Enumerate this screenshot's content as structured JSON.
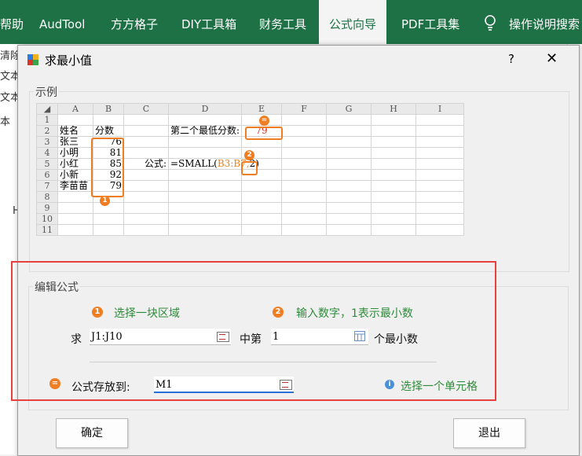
{
  "ribbon": {
    "tabs": [
      "帮助",
      "AudTool",
      "方方格子",
      "DIY工具箱",
      "财务工具",
      "公式向导",
      "PDF工具集",
      "操作说明搜索"
    ]
  },
  "bg_sheet": {
    "texts": [
      "清除",
      "文本",
      "文本",
      "本",
      "H"
    ]
  },
  "dialog": {
    "title": "求最小值",
    "help_label": "?",
    "close_label": "✕",
    "example_group": {
      "title": "示例",
      "columns": [
        "A",
        "B",
        "C",
        "D",
        "E",
        "F",
        "G",
        "H",
        "I"
      ],
      "rows": [
        "1",
        "2",
        "3",
        "4",
        "5",
        "6",
        "7",
        "8",
        "9",
        "10",
        "11"
      ],
      "names_header": "姓名",
      "scores_header": "分数",
      "names": [
        "张三",
        "小明",
        "小红",
        "小新",
        "李苗苗"
      ],
      "scores": [
        "76",
        "81",
        "85",
        "92",
        "79"
      ],
      "label_second_lowest": "第二个最低分数:",
      "result_value": "79",
      "formula_label": "公式:",
      "formula_prefix": "=SMALL(",
      "formula_range": "B3:B7,",
      "formula_k": "2",
      "formula_suffix": ")",
      "badges": [
        "1",
        "2",
        "="
      ]
    },
    "edit_group": {
      "title": "编辑公式",
      "step1_number": "1",
      "step1_tip": "选择一块区域",
      "step2_number": "2",
      "step2_tip": "输入数字，1表示最小数",
      "label_find": "求",
      "range_value": "J1:J10",
      "label_middle": "中第",
      "k_value": "1",
      "label_nth_min": "个最小数",
      "output_number": "=",
      "label_output": "公式存放到:",
      "output_value": "M1",
      "hint_text": "选择一个单元格"
    },
    "ok_label": "确定",
    "exit_label": "退出"
  }
}
